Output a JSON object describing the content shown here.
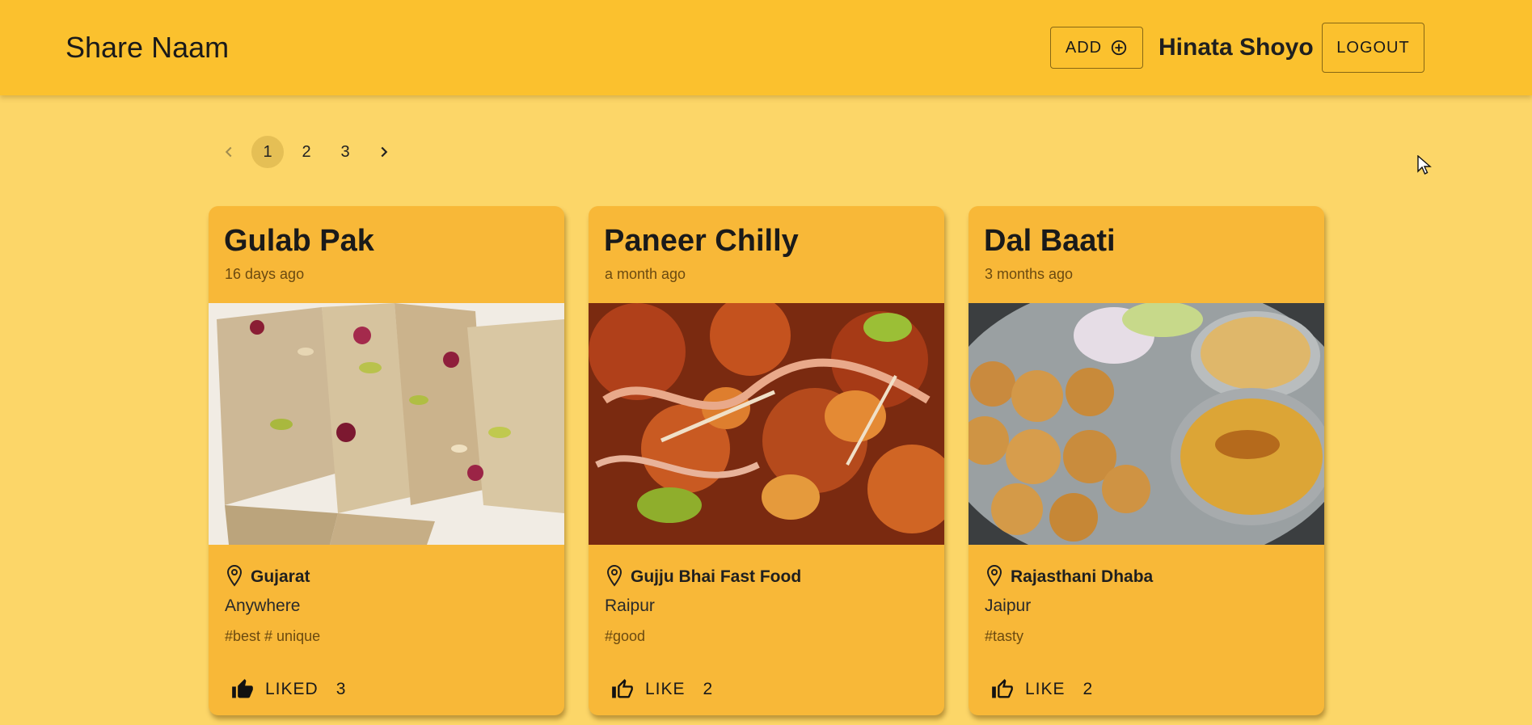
{
  "appbar": {
    "brand": "Share Naam",
    "add_label": "ADD",
    "user_name": "Hinata Shoyo",
    "logout_label": "LOGOUT"
  },
  "pagination": {
    "pages": [
      "1",
      "2",
      "3"
    ],
    "current": "1"
  },
  "cards": [
    {
      "title": "Gulab Pak",
      "time": "16 days ago",
      "place": "Gujarat",
      "city": "Anywhere",
      "tags": "#best # unique",
      "like_label": "LIKED",
      "like_count": "3",
      "liked": true
    },
    {
      "title": "Paneer Chilly",
      "time": "a month ago",
      "place": "Gujju Bhai Fast Food",
      "city": "Raipur",
      "tags": "#good",
      "like_label": "LIKE",
      "like_count": "2",
      "liked": false
    },
    {
      "title": "Dal Baati",
      "time": "3 months ago",
      "place": "Rajasthani Dhaba",
      "city": "Jaipur",
      "tags": "#tasty",
      "like_label": "LIKE",
      "like_count": "2",
      "liked": false
    }
  ],
  "colors": {
    "background": "#fcd668",
    "appbar": "#fbc12e",
    "card": "#f8b838"
  },
  "icons": {
    "add": "add-circle-icon",
    "prev": "chevron-left-icon",
    "next": "chevron-right-icon",
    "location": "location-pin-icon",
    "liked": "thumb-up-filled-icon",
    "like": "thumb-up-outline-icon"
  }
}
